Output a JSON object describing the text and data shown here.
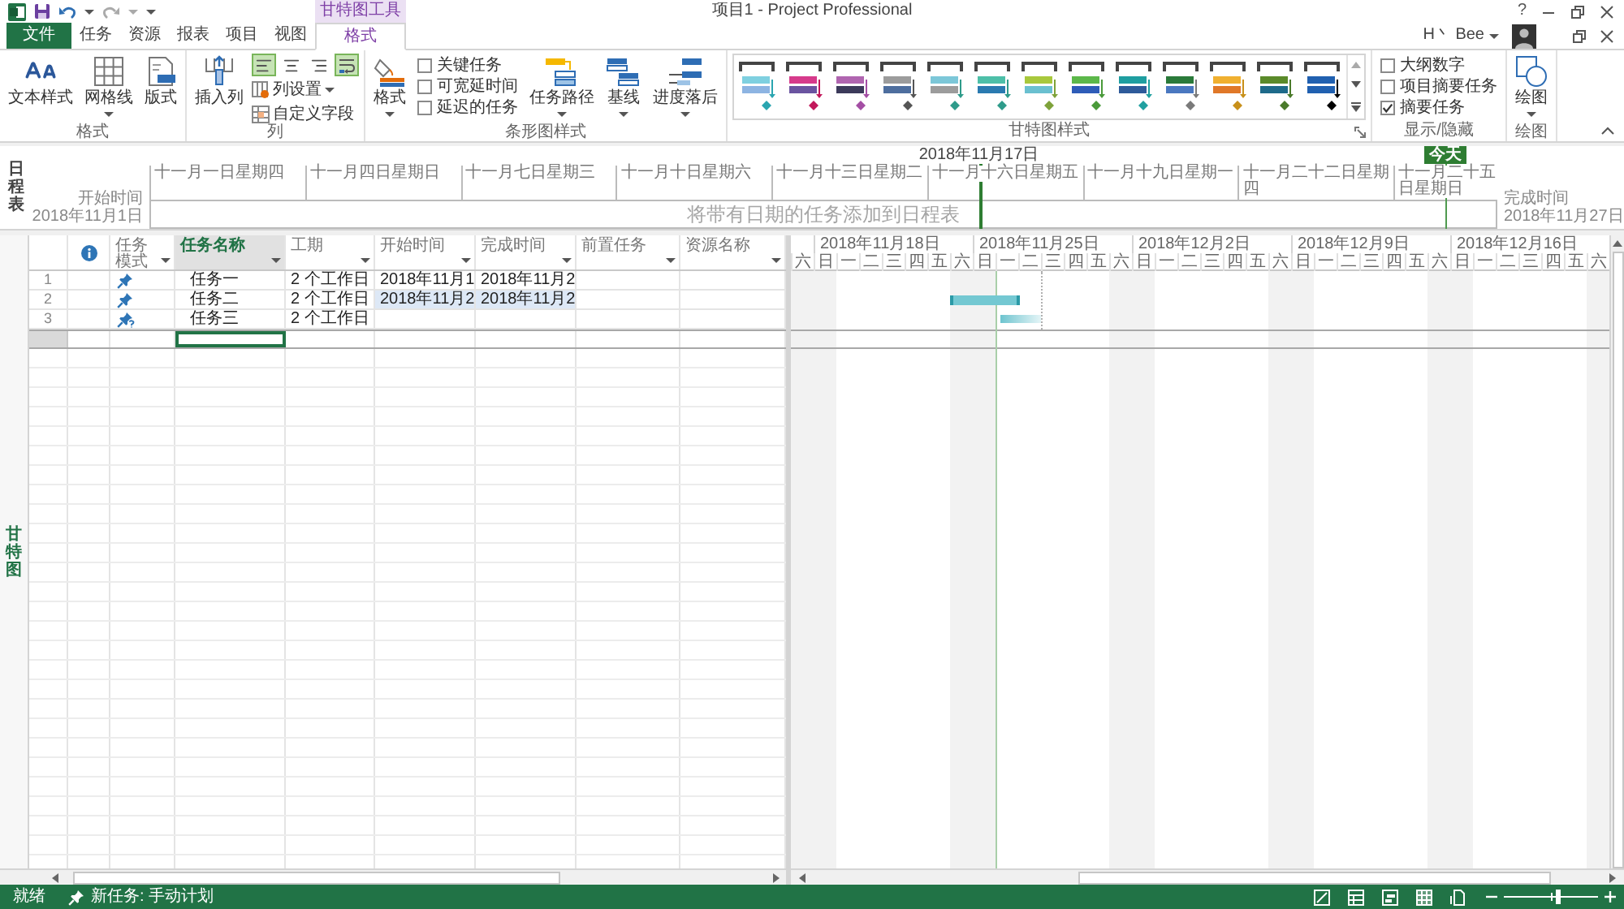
{
  "window": {
    "title": "项目1 - Project Professional",
    "context_tab": "甘特图工具",
    "help": "?"
  },
  "tabs": [
    {
      "label": "文件",
      "kind": "file",
      "selected": false
    },
    {
      "label": "任务",
      "kind": "tab",
      "selected": false
    },
    {
      "label": "资源",
      "kind": "tab",
      "selected": false
    },
    {
      "label": "报表",
      "kind": "tab",
      "selected": false
    },
    {
      "label": "项目",
      "kind": "tab",
      "selected": false
    },
    {
      "label": "视图",
      "kind": "tab",
      "selected": false
    },
    {
      "label": "格式",
      "kind": "context",
      "selected": true
    }
  ],
  "account": {
    "name": "H丶 Bee"
  },
  "ribbon": {
    "format_group": {
      "label": "格式",
      "buttons": [
        {
          "label": "文本样式",
          "kind": "text_styles",
          "dropdown": false
        },
        {
          "label": "网格线",
          "kind": "gridlines",
          "dropdown": true
        },
        {
          "label": "版式",
          "kind": "layout",
          "dropdown": false
        }
      ]
    },
    "columns_group": {
      "label": "列",
      "insert": "插入列",
      "align": [
        {
          "kind": "left",
          "selected": true
        },
        {
          "kind": "center",
          "selected": false
        },
        {
          "kind": "right",
          "selected": false
        },
        {
          "kind": "wrap",
          "selected": true
        }
      ],
      "settings": {
        "label": "列设置",
        "dropdown": true
      },
      "custom_fields": "自定义字段"
    },
    "bar_styles_group": {
      "label": "条形图样式",
      "format": {
        "label": "格式",
        "dropdown": true
      },
      "checks": [
        {
          "label": "关键任务",
          "checked": false
        },
        {
          "label": "可宽延时间",
          "checked": false
        },
        {
          "label": "延迟的任务",
          "checked": false
        }
      ],
      "buttons": [
        {
          "label": "任务路径",
          "kind": "task_path",
          "dropdown": true
        },
        {
          "label": "基线",
          "kind": "baseline",
          "dropdown": true
        },
        {
          "label": "进度落后",
          "kind": "slippage",
          "dropdown": true
        }
      ]
    },
    "gantt_styles_group": {
      "label": "甘特图样式",
      "styles": [
        {
          "selected": false,
          "color": "#2aa5b0",
          "bars": [
            {
              "color": "#7fd0e0"
            },
            {
              "color": "#8db4e2"
            }
          ]
        },
        {
          "selected": false,
          "color": "#c2185b",
          "bars": [
            {
              "color": "#d63a8b"
            },
            {
              "color": "#6a54a0"
            }
          ]
        },
        {
          "selected": false,
          "color": "#a44ea4",
          "bars": [
            {
              "color": "#b065b0"
            },
            {
              "color": "#3c3a5a"
            }
          ]
        },
        {
          "selected": false,
          "color": "#555555",
          "bars": [
            {
              "color": "#9c9c9c"
            },
            {
              "color": "#4e6e9e"
            }
          ]
        },
        {
          "selected": false,
          "color": "#2e9b8a",
          "bars": [
            {
              "color": "#7cc7d8"
            },
            {
              "color": "#9c9c9c"
            }
          ]
        },
        {
          "selected": false,
          "color": "#2e9b8a",
          "bars": [
            {
              "color": "#4dbfa8"
            },
            {
              "color": "#2a7ab0"
            }
          ]
        },
        {
          "selected": false,
          "color": "#7ea23a",
          "bars": [
            {
              "color": "#a8c83c"
            },
            {
              "color": "#6ac0d0"
            }
          ]
        },
        {
          "selected": false,
          "color": "#4a9a3a",
          "bars": [
            {
              "color": "#5cb84a"
            },
            {
              "color": "#2e5cb8"
            }
          ]
        },
        {
          "selected": false,
          "color": "#20a0a0",
          "bars": [
            {
              "color": "#1e9ea0"
            },
            {
              "color": "#2e5a9a"
            }
          ]
        },
        {
          "selected": false,
          "color": "#7a7a7a",
          "bars": [
            {
              "color": "#2a7a3a"
            },
            {
              "color": "#4a78c0"
            }
          ]
        },
        {
          "selected": false,
          "color": "#c8901a",
          "bars": [
            {
              "color": "#f0b030"
            },
            {
              "color": "#e07828"
            }
          ]
        },
        {
          "selected": false,
          "color": "#4a7a2a",
          "bars": [
            {
              "color": "#5a8a2a"
            },
            {
              "color": "#1e6a8a"
            }
          ]
        },
        {
          "selected": false,
          "color": "#000000",
          "bars": [
            {
              "color": "#2060b0"
            },
            {
              "color": "#2060b0"
            }
          ]
        }
      ]
    },
    "show_hide_group": {
      "label": "显示/隐藏",
      "checks": [
        {
          "label": "大纲数字",
          "checked": false
        },
        {
          "label": "项目摘要任务",
          "checked": false
        },
        {
          "label": "摘要任务",
          "checked": true
        }
      ]
    },
    "drawing_group": {
      "label": "绘图",
      "button": {
        "label": "绘图",
        "dropdown": true
      }
    }
  },
  "timeline": {
    "side_label": "日程表",
    "view_start": "2018年11月17日",
    "today": "今天",
    "start": {
      "label": "开始时间",
      "date": "2018年11月1日"
    },
    "finish": {
      "label": "完成时间",
      "date": "2018年11月27日"
    },
    "ticks": [
      "十一月一日星期四",
      "十一月四日星期日",
      "十一月七日星期三",
      "十一月十日星期六",
      "十一月十三日星期二",
      "十一月十六日星期五",
      "十一月十九日星期一",
      "十一月二十二日星期四",
      "十一月二十五日星期日"
    ],
    "empty_message": "将带有日期的任务添加到日程表"
  },
  "gantt_view": {
    "side_label": "甘特图",
    "columns": [
      {
        "label": "任务模式",
        "selected": false
      },
      {
        "label": "任务名称",
        "selected": true
      },
      {
        "label": "工期",
        "selected": false
      },
      {
        "label": "开始时间",
        "selected": false
      },
      {
        "label": "完成时间",
        "selected": false
      },
      {
        "label": "前置任务",
        "selected": false
      },
      {
        "label": "资源名称",
        "selected": false
      }
    ],
    "tasks": [
      {
        "number": "1",
        "kind": "manual",
        "name": "任务一",
        "duration": "2 个工作日",
        "start": "2018年11月1",
        "finish": "2018年11月2",
        "dates_changed": false
      },
      {
        "number": "2",
        "kind": "manual",
        "name": "任务二",
        "duration": "2 个工作日",
        "start": "2018年11月2",
        "finish": "2018年11月2",
        "dates_changed": true,
        "bar": {
          "kind": "solid"
        }
      },
      {
        "number": "3",
        "kind": "manual_incomplete",
        "name": "任务三",
        "duration": "2 个工作日",
        "dates_changed": false,
        "bar": {
          "kind": "faded"
        }
      }
    ],
    "entry_row": {
      "selected": true
    },
    "timescale": {
      "weeks": [
        "2018年11月18日",
        "2018年11月25日",
        "2018年12月2日",
        "2018年12月9日",
        "2018年12月16日"
      ],
      "days": [
        {
          "label": "六",
          "nonworking": true
        },
        {
          "label": "日",
          "nonworking": true
        },
        {
          "label": "一",
          "nonworking": false
        },
        {
          "label": "二",
          "nonworking": false
        },
        {
          "label": "三",
          "nonworking": false
        },
        {
          "label": "四",
          "nonworking": false
        },
        {
          "label": "五",
          "nonworking": false
        },
        {
          "label": "六",
          "nonworking": true
        },
        {
          "label": "日",
          "nonworking": true
        },
        {
          "label": "一",
          "nonworking": false
        },
        {
          "label": "二",
          "nonworking": false
        },
        {
          "label": "三",
          "nonworking": false
        },
        {
          "label": "四",
          "nonworking": false
        },
        {
          "label": "五",
          "nonworking": false
        },
        {
          "label": "六",
          "nonworking": true
        },
        {
          "label": "日",
          "nonworking": true
        },
        {
          "label": "一",
          "nonworking": false
        },
        {
          "label": "二",
          "nonworking": false
        },
        {
          "label": "三",
          "nonworking": false
        },
        {
          "label": "四",
          "nonworking": false
        },
        {
          "label": "五",
          "nonworking": false
        },
        {
          "label": "六",
          "nonworking": true
        },
        {
          "label": "日",
          "nonworking": true
        },
        {
          "label": "一",
          "nonworking": false
        },
        {
          "label": "二",
          "nonworking": false
        },
        {
          "label": "三",
          "nonworking": false
        },
        {
          "label": "四",
          "nonworking": false
        },
        {
          "label": "五",
          "nonworking": false
        },
        {
          "label": "六",
          "nonworking": true
        },
        {
          "label": "日",
          "nonworking": true
        },
        {
          "label": "一",
          "nonworking": false
        },
        {
          "label": "二",
          "nonworking": false
        },
        {
          "label": "三",
          "nonworking": false
        },
        {
          "label": "四",
          "nonworking": false
        },
        {
          "label": "五",
          "nonworking": false
        },
        {
          "label": "六",
          "nonworking": true
        }
      ]
    }
  },
  "status_bar": {
    "ready": "就绪",
    "new_task": "新任务: 手动计划",
    "zoom": {
      "level": 0.57
    }
  }
}
